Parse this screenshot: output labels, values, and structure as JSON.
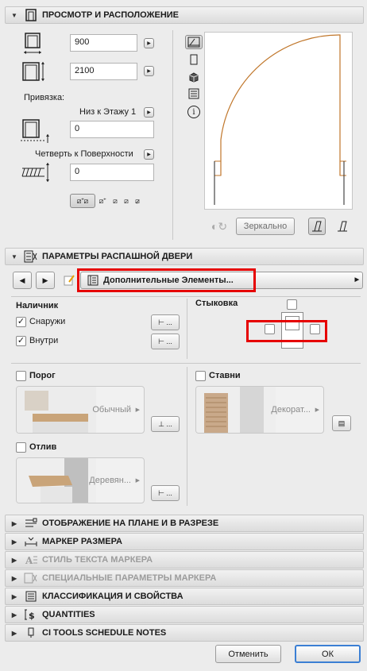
{
  "section_view": {
    "title": "ПРОСМОТР И РАСПОЛОЖЕНИЕ",
    "width_value": "900",
    "height_value": "2100",
    "anchor_label": "Привязка:",
    "anchor_value": "Низ к Этажу 1",
    "anchor_offset_value": "0",
    "reveal_label": "Четверть к Поверхности",
    "reveal_value": "0",
    "mirror_label": "Зеркально"
  },
  "section_params": {
    "title": "ПАРАМЕТРЫ РАСПАШНОЙ ДВЕРИ",
    "page_selector": "Дополнительные Элементы..."
  },
  "casing": {
    "title": "Наличник",
    "outside_label": "Снаружи",
    "outside_checked": true,
    "inside_label": "Внутри",
    "inside_checked": true
  },
  "joint": {
    "title": "Стыковка"
  },
  "threshold": {
    "label": "Порог",
    "value": "Обычный"
  },
  "shutters": {
    "label": "Ставни",
    "value": "Декорат..."
  },
  "sill": {
    "label": "Отлив",
    "value": "Деревян..."
  },
  "collapsed_sections": [
    {
      "title": "ОТОБРАЖЕНИЕ НА ПЛАНЕ И В РАЗРЕЗЕ",
      "enabled": true
    },
    {
      "title": "МАРКЕР РАЗМЕРА",
      "enabled": true
    },
    {
      "title": "СТИЛЬ ТЕКСТА МАРКЕРА",
      "enabled": false
    },
    {
      "title": "СПЕЦИАЛЬНЫЕ ПАРАМЕТРЫ МАРКЕРА",
      "enabled": false
    },
    {
      "title": "КЛАССИФИКАЦИЯ И СВОЙСТВА",
      "enabled": true
    },
    {
      "title": "QUANTITIES",
      "enabled": true
    },
    {
      "title": "CI TOOLS SCHEDULE NOTES",
      "enabled": true
    }
  ],
  "footer": {
    "cancel_label": "Отменить",
    "ok_label": "ОК"
  },
  "colors": {
    "highlight": "#e60000",
    "door_arc": "#c0762a",
    "ok_border": "#3b7fd4"
  }
}
